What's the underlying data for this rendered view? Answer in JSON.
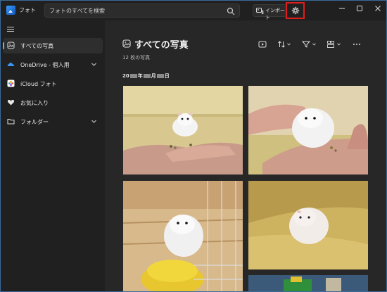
{
  "app": {
    "title": "フォト",
    "search_placeholder": "フォトのすべてを検索",
    "import_label": "インポート",
    "accent_color": "#5fb2ff",
    "highlight_color": "#e01c1c"
  },
  "sidebar": {
    "items": [
      {
        "label": "すべての写真",
        "icon": "photos-icon",
        "selected": true,
        "expandable": false
      },
      {
        "label": "OneDrive - 個人用",
        "icon": "onedrive-icon",
        "selected": false,
        "expandable": true
      },
      {
        "label": "iCloud フォト",
        "icon": "icloud-icon",
        "selected": false,
        "expandable": false
      },
      {
        "label": "お気に入り",
        "icon": "heart-icon",
        "selected": false,
        "expandable": false
      },
      {
        "label": "フォルダー",
        "icon": "folder-icon",
        "selected": false,
        "expandable": true
      }
    ]
  },
  "main": {
    "title": "すべての写真",
    "photo_count": "12 枚の写真",
    "date_heading_parts": [
      "20",
      "年",
      "月",
      "日"
    ],
    "toolbar": [
      "slideshow-icon",
      "sort-icon",
      "filter-icon",
      "view-icon",
      "more-icon"
    ],
    "photos": [
      {
        "subject": "hamster on hand"
      },
      {
        "subject": "hamster in cupped hands"
      },
      {
        "subject": "hamster eating from yellow dish"
      },
      {
        "subject": "hamster on sofa"
      },
      {
        "subject": "green toy"
      }
    ]
  }
}
